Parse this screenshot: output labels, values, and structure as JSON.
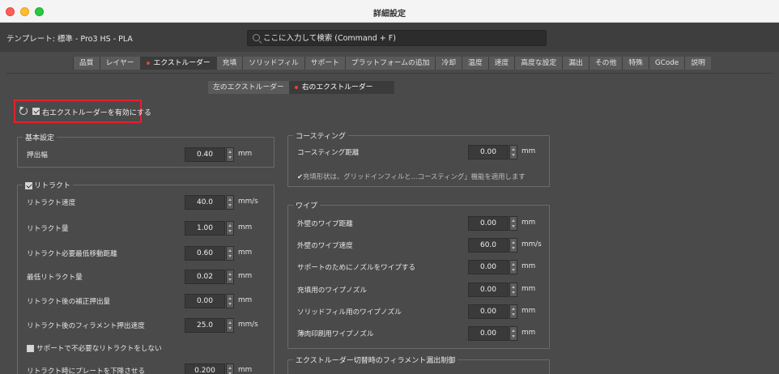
{
  "window": {
    "title": "詳細設定"
  },
  "header": {
    "template_label": "テンプレート: 標準 - Pro3 HS - PLA",
    "search_placeholder": "ここに入力して検索 (Command + F)"
  },
  "tabs": [
    {
      "label": "品質",
      "active": false
    },
    {
      "label": "レイヤー",
      "active": false
    },
    {
      "label": "エクストルーダー",
      "active": true,
      "dot": true
    },
    {
      "label": "充填",
      "active": false
    },
    {
      "label": "ソリッドフィル",
      "active": false
    },
    {
      "label": "サポート",
      "active": false
    },
    {
      "label": "プラットフォームの追加",
      "active": false
    },
    {
      "label": "冷却",
      "active": false
    },
    {
      "label": "温度",
      "active": false
    },
    {
      "label": "速度",
      "active": false
    },
    {
      "label": "高度な設定",
      "active": false
    },
    {
      "label": "漏出",
      "active": false
    },
    {
      "label": "その他",
      "active": false
    },
    {
      "label": "特殊",
      "active": false
    },
    {
      "label": "GCode",
      "active": false
    },
    {
      "label": "説明",
      "active": false
    }
  ],
  "subtabs": [
    {
      "label": "左のエクストルーダー",
      "active": false
    },
    {
      "label": "右のエクストルーダー",
      "active": true,
      "dot": true
    }
  ],
  "enable_right": {
    "label": "右エクストルーダーを有効にする",
    "checked": true
  },
  "basic": {
    "title": "基本設定",
    "fields": [
      {
        "label": "押出幅",
        "value": "0.40",
        "unit": "mm"
      }
    ]
  },
  "retract": {
    "title": "リトラクト",
    "checked": true,
    "fields": [
      {
        "label": "リトラクト速度",
        "value": "40.0",
        "unit": "mm/s"
      },
      {
        "label": "リトラクト量",
        "value": "1.00",
        "unit": "mm"
      },
      {
        "label": "リトラクト必要最低移動距離",
        "value": "0.60",
        "unit": "mm"
      },
      {
        "label": "最低リトラクト量",
        "value": "0.02",
        "unit": "mm"
      },
      {
        "label": "リトラクト後の補正押出量",
        "value": "0.00",
        "unit": "mm"
      },
      {
        "label": "リトラクト後のフィラメント押出速度",
        "value": "25.0",
        "unit": "mm/s"
      }
    ],
    "no_retract_support": {
      "label": "サポートで不必要なリトラクトをしない",
      "checked": false
    },
    "lower_plate": {
      "label": "リトラクト時にプレートを下降させる",
      "value": "0.200",
      "unit": "mm"
    }
  },
  "coasting": {
    "title": "コースティング",
    "fields": [
      {
        "label": "コースティング距離",
        "value": "0.00",
        "unit": "mm"
      }
    ],
    "note": "充填形状は、グリッドインフィルと...コースティング」機能を適用します"
  },
  "wipe": {
    "title": "ワイプ",
    "fields": [
      {
        "label": "外壁のワイプ距離",
        "value": "0.00",
        "unit": "mm"
      },
      {
        "label": "外壁のワイプ速度",
        "value": "60.0",
        "unit": "mm/s"
      },
      {
        "label": "サポートのためにノズルをワイプする",
        "value": "0.00",
        "unit": "mm"
      },
      {
        "label": "充填用のワイプノズル",
        "value": "0.00",
        "unit": "mm"
      },
      {
        "label": "ソリッドフィル用のワイプノズル",
        "value": "0.00",
        "unit": "mm"
      },
      {
        "label": "薄肉印刷用ワイプノズル",
        "value": "0.00",
        "unit": "mm"
      }
    ]
  },
  "ooze_control": {
    "title": "エクストルーダー切替時のフィラメント漏出制御"
  }
}
